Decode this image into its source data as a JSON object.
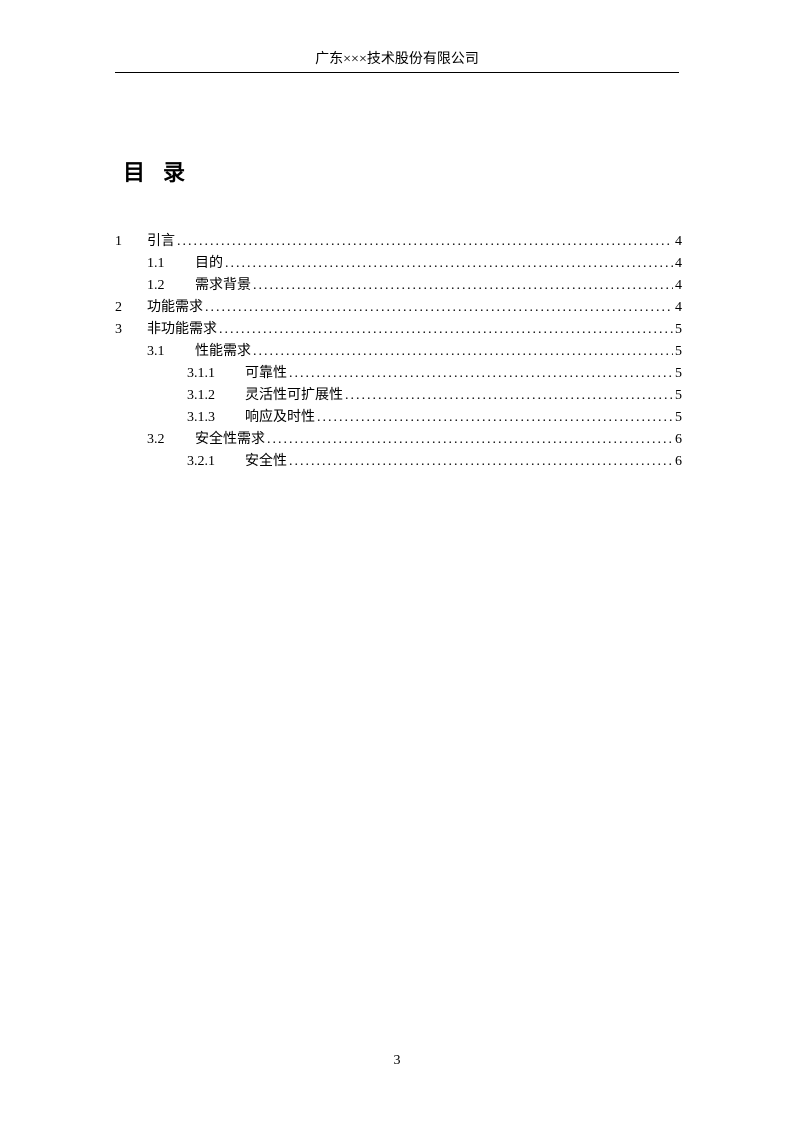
{
  "header": {
    "company": "广东×××技术股份有限公司"
  },
  "title": "目录",
  "toc": [
    {
      "level": 1,
      "num": "1",
      "label": "引言",
      "page": "4"
    },
    {
      "level": 2,
      "num": "1.1",
      "label": "目的",
      "page": "4"
    },
    {
      "level": 2,
      "num": "1.2",
      "label": "需求背景",
      "page": "4"
    },
    {
      "level": 1,
      "num": "2",
      "label": "功能需求",
      "page": "4"
    },
    {
      "level": 1,
      "num": "3",
      "label": "非功能需求",
      "page": "5"
    },
    {
      "level": 2,
      "num": "3.1",
      "label": "性能需求",
      "page": "5"
    },
    {
      "level": 3,
      "num": "3.1.1",
      "label": "可靠性",
      "page": "5"
    },
    {
      "level": 3,
      "num": "3.1.2",
      "label": "灵活性可扩展性",
      "page": "5"
    },
    {
      "level": 3,
      "num": "3.1.3",
      "label": "响应及时性",
      "page": "5"
    },
    {
      "level": 2,
      "num": "3.2",
      "label": "安全性需求",
      "page": "6"
    },
    {
      "level": 3,
      "num": "3.2.1",
      "label": "安全性",
      "page": "6"
    }
  ],
  "page_number": "3"
}
